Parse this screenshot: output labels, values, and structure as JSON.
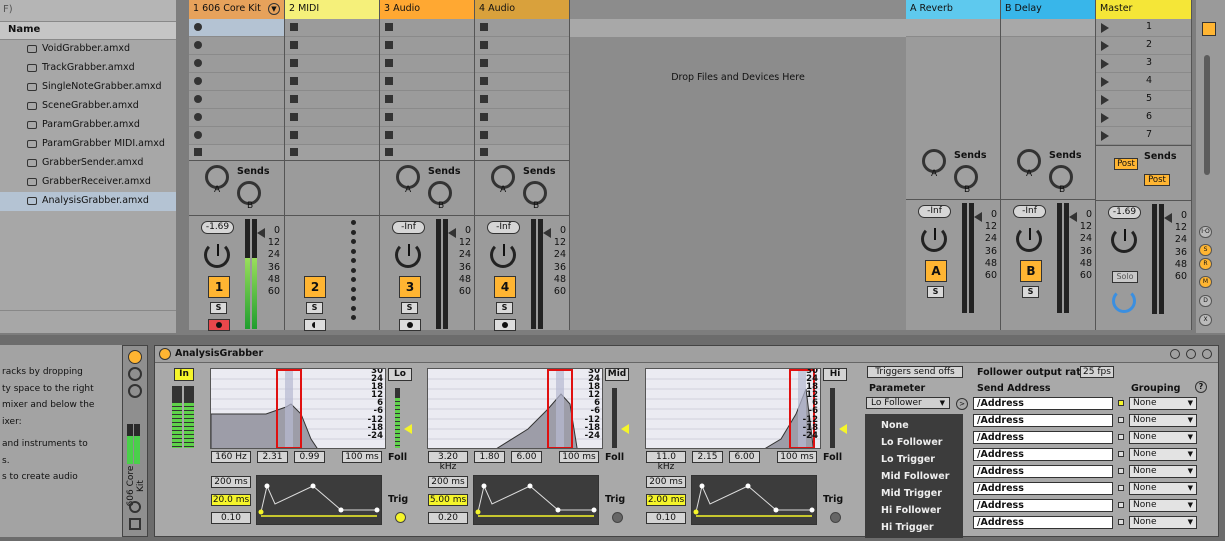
{
  "browser": {
    "top_text": "F)",
    "column_header": "Name",
    "items": [
      "VoidGrabber.amxd",
      "TrackGrabber.amxd",
      "SingleNoteGrabber.amxd",
      "SceneGrabber.amxd",
      "ParamGrabber.amxd",
      "ParamGrabber MIDI.amxd",
      "GrabberSender.amxd",
      "GrabberReceiver.amxd",
      "AnalysisGrabber.amxd"
    ],
    "selected_index": 8
  },
  "tracks": [
    {
      "name": "1 606 Core Kit",
      "color": "#e7a25b",
      "volume": "-1.69",
      "num": "1",
      "meter_level": 0.65
    },
    {
      "name": "2 MIDI",
      "color": "#f5f07a",
      "volume": "",
      "num": "2",
      "meter_level": 0
    },
    {
      "name": "3 Audio",
      "color": "#ffa832",
      "volume": "-Inf",
      "num": "3",
      "meter_level": 0
    },
    {
      "name": "4 Audio",
      "color": "#d9a13c",
      "volume": "-Inf",
      "num": "4",
      "meter_level": 0
    }
  ],
  "returns": [
    {
      "name": "A Reverb",
      "color": "#5ec9ee",
      "volume": "-Inf",
      "num": "A"
    },
    {
      "name": "B Delay",
      "color": "#38b6ea",
      "volume": "-Inf",
      "num": "B"
    }
  ],
  "master": {
    "name": "Master",
    "color": "#f5e637",
    "volume": "-1.69",
    "solo": "Solo",
    "post": "Post",
    "scenes": [
      "1",
      "2",
      "3",
      "4",
      "5",
      "6",
      "7"
    ]
  },
  "drop_text": "Drop Files and Devices Here",
  "sends_label": "Sends",
  "solo_label": "S",
  "knob_a": "A",
  "knob_b": "B",
  "meter_scale": [
    "0",
    "12",
    "24",
    "36",
    "48",
    "60"
  ],
  "info_lines": [
    "racks by dropping",
    "ty space to the right",
    "mixer and below the",
    "ixer:",
    "and instruments to",
    "s.",
    "s to create audio"
  ],
  "device_strip": {
    "track_name": "606 Core Kit"
  },
  "device": {
    "title": "AnalysisGrabber",
    "in_label": "In",
    "bands": [
      {
        "label": "Lo",
        "freq": "160 Hz",
        "q": "2.31",
        "gain": "0.99",
        "time": "100 ms",
        "foll": "Foll",
        "attack": "200 ms",
        "release": "20.0 ms",
        "amt": "0.10",
        "trig": "Trig",
        "trig_on": true
      },
      {
        "label": "Mid",
        "freq": "3.20 kHz",
        "q": "1.80",
        "gain": "6.00",
        "time": "100 ms",
        "foll": "Foll",
        "attack": "200 ms",
        "release": "5.00 ms",
        "amt": "0.20",
        "trig": "Trig",
        "trig_on": false
      },
      {
        "label": "Hi",
        "freq": "11.0 kHz",
        "q": "2.15",
        "gain": "6.00",
        "time": "100 ms",
        "foll": "Foll",
        "attack": "200 ms",
        "release": "2.00 ms",
        "amt": "0.10",
        "trig": "Trig",
        "trig_on": false
      }
    ],
    "plot_scale": [
      "30",
      "24",
      "18",
      "12",
      "6",
      "-6",
      "-12",
      "-18",
      "-24"
    ],
    "triggers_btn": "Triggers send offs",
    "follower_rate_label": "Follower output rate",
    "follower_rate": "25 fps",
    "param_label": "Parameter",
    "param_selected": "Lo Follower",
    "send_addr_label": "Send Address",
    "grouping_label": "Grouping",
    "help": "?",
    "menu_items": [
      "None",
      "Lo Follower",
      "Lo Trigger",
      "Mid Follower",
      "Mid Trigger",
      "Hi Follower",
      "Hi Trigger"
    ],
    "addresses": [
      "/Address",
      "/Address",
      "/Address",
      "/Address",
      "/Address",
      "/Address",
      "/Address",
      "/Address"
    ],
    "groupings": [
      "None",
      "None",
      "None",
      "None",
      "None",
      "None",
      "None",
      "None"
    ]
  }
}
